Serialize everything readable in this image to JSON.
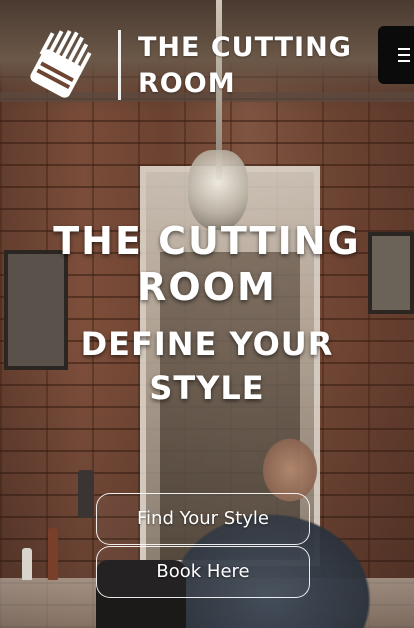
{
  "header": {
    "brand_line1": "THE CUTTING",
    "brand_line2": "ROOM",
    "logo_icon": "comb-clipper-icon",
    "menu_icon": "hamburger-menu-icon"
  },
  "hero": {
    "title_line1": "THE CUTTING",
    "title_line2": "ROOM",
    "subtitle_line1": "DEFINE YOUR",
    "subtitle_line2": "STYLE"
  },
  "actions": {
    "find_style_label": "Find Your Style",
    "book_label": "Book Here"
  },
  "colors": {
    "text": "#ffffff",
    "menu_bg": "#0b0b0b",
    "brick": "#8a5640"
  }
}
